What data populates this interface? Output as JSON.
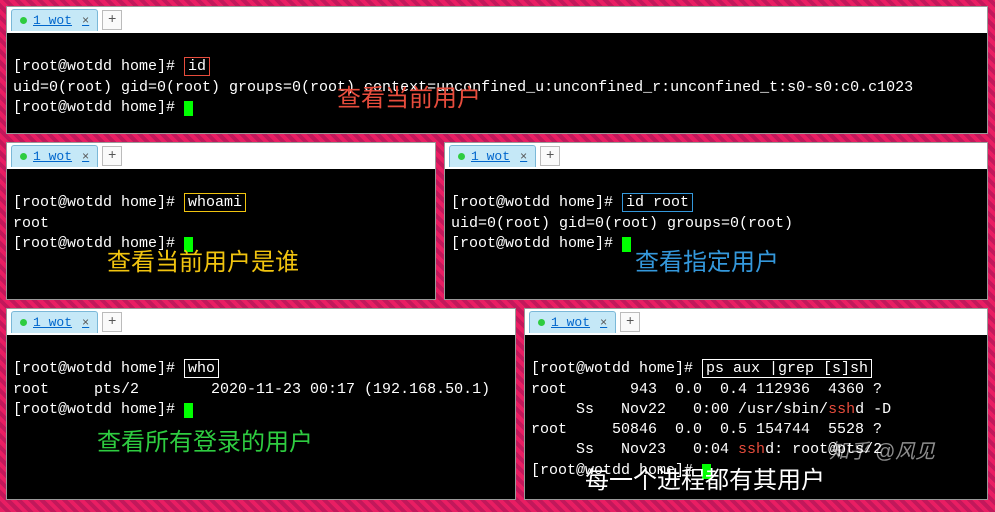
{
  "tab_label": "1 wot",
  "prompt": "[root@wotdd home]# ",
  "panes": {
    "p1": {
      "cmd": "id",
      "out": "uid=0(root) gid=0(root) groups=0(root) context=unconfined_u:unconfined_r:unconfined_t:s0-s0:c0.c1023",
      "caption": "查看当前用户",
      "caption_class": "hl-red"
    },
    "p2": {
      "cmd": "whoami",
      "out": "root",
      "caption": "查看当前用户是谁",
      "caption_color": "#f1c40f"
    },
    "p3": {
      "cmd": "id root",
      "out": "uid=0(root) gid=0(root) groups=0(root)",
      "caption": "查看指定用户",
      "caption_color": "#3498db"
    },
    "p4": {
      "cmd": "who",
      "out": "root     pts/2        2020-11-23 00:17 (192.168.50.1)",
      "caption": "查看所有登录的用户",
      "caption_color": "#2ecc40"
    },
    "p5": {
      "cmd": "ps aux |grep [s]sh",
      "lines": [
        "root       943  0.0  0.4 112936  4360 ?",
        "     Ss   Nov22   0:00 /usr/sbin/sshd -D",
        "root     50846  0.0  0.5 154744  5528 ?",
        "     Ss   Nov23   0:04 sshd: root@pts/2"
      ],
      "ssh_hl": "ssh",
      "caption": "每一个进程都有其用户",
      "caption_color": "#ffffff"
    }
  },
  "watermark": "知乎 @风见"
}
